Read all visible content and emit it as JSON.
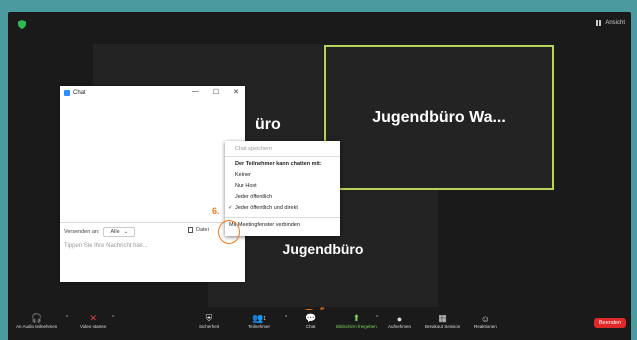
{
  "top": {
    "view_label": "Ansicht"
  },
  "tiles": {
    "tile1_name": "üro",
    "tile2_name": "Jugendbüro  Wa...",
    "tile3_name": "Jugendbüro"
  },
  "chat": {
    "title": "Chat",
    "send_to_label": "Versenden an:",
    "send_to_value": "Alle",
    "file_label": "Datei",
    "more_label": "...",
    "input_placeholder": "Tippen Sie Ihre Nachricht hier..."
  },
  "menu": {
    "save_chat": "Chat speichern",
    "heading": "Der Teilnehmer kann chatten mit:",
    "opt_none": "Keiner",
    "opt_host": "Nur Host",
    "opt_public": "Jeder öffentlich",
    "opt_all": "Jeder öffentlich und direkt",
    "checkmark": "✓",
    "merge": "Mit Meetingfenster verbinden"
  },
  "annotations": {
    "step6": "6.",
    "step5": "5."
  },
  "toolbar": {
    "audio": "An Audio teilnehmen",
    "video": "Video starten",
    "security": "Sicherheit",
    "participants": "Teilnehmer",
    "participants_count": "1",
    "chat": "Chat",
    "share": "Bildschirm freigeben",
    "record": "Aufnehmen",
    "breakout": "Breakout Session",
    "reactions": "Reaktionen",
    "end": "Beenden"
  },
  "colors": {
    "accent_green": "#7cd45a",
    "highlight_border": "#b7d35a",
    "annotation": "#f07a1c",
    "end_red": "#e02828",
    "outer_bg": "#4a9aa0"
  }
}
